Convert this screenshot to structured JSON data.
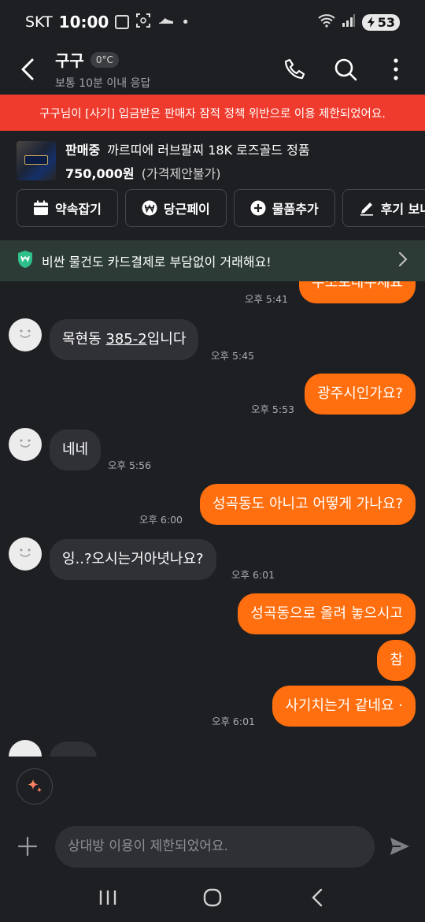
{
  "status_bar": {
    "carrier": "SKT",
    "time": "10:00",
    "notification_dot": "•",
    "battery": "53"
  },
  "header": {
    "name": "구구",
    "temperature": "0°C",
    "response_time": "보통 10분 이내 응답"
  },
  "restriction_banner": "구구님이 [사기] 입금받은 판매자 잠적 정책 위반으로 이용 제한되었어요.",
  "product": {
    "status": "판매중",
    "title": "까르띠에 러브팔찌 18K 로즈골드 정품",
    "price": "750,000원",
    "price_note": "(가격제안불가)"
  },
  "actions": {
    "appointment": "약속잡기",
    "pay": "당근페이",
    "add_item": "물품추가",
    "review": "후기 보내기"
  },
  "card_banner": "비싼 물건도 카드결제로 부담없이 거래해요!",
  "messages": {
    "m0": {
      "text": "주소보내주세요",
      "time": "오후 5:41"
    },
    "m1": {
      "text_a": "목현동 ",
      "text_link": "385-2",
      "text_b": "입니다",
      "time": "오후 5:45"
    },
    "m2": {
      "text": "광주시인가요?",
      "time": "오후 5:53"
    },
    "m3": {
      "text": "네네",
      "time": "오후 5:56"
    },
    "m4": {
      "text": "성곡동도 아니고 어떻게 가나요?",
      "time": "오후 6:00"
    },
    "m5": {
      "text": "잉..?오시는거아녓나요?",
      "time": "오후 6:01"
    },
    "m6": {
      "text": "성곡동으로 올려 놓으시고"
    },
    "m7": {
      "text": "참"
    },
    "m8": {
      "text": "사기치는거 같네요 ·",
      "time": "오후 6:01"
    }
  },
  "input": {
    "placeholder": "상대방 이용이 제한되었어요."
  },
  "colors": {
    "accent": "#ff6f0f",
    "banner_red": "#ef3b2d",
    "background": "#1e1f22",
    "bubble_other": "#303136",
    "card_banner_bg": "#2c3b36",
    "card_banner_icon": "#2fbf8a"
  },
  "icons": [
    "back-arrow-icon",
    "phone-icon",
    "search-icon",
    "more-vertical-icon",
    "calendar-icon",
    "won-coin-icon",
    "plus-circle-icon",
    "pencil-icon",
    "shield-won-icon",
    "chevron-right-icon",
    "sparkle-icon",
    "plus-icon",
    "send-icon",
    "nav-recents-icon",
    "nav-home-icon",
    "nav-back-icon"
  ]
}
